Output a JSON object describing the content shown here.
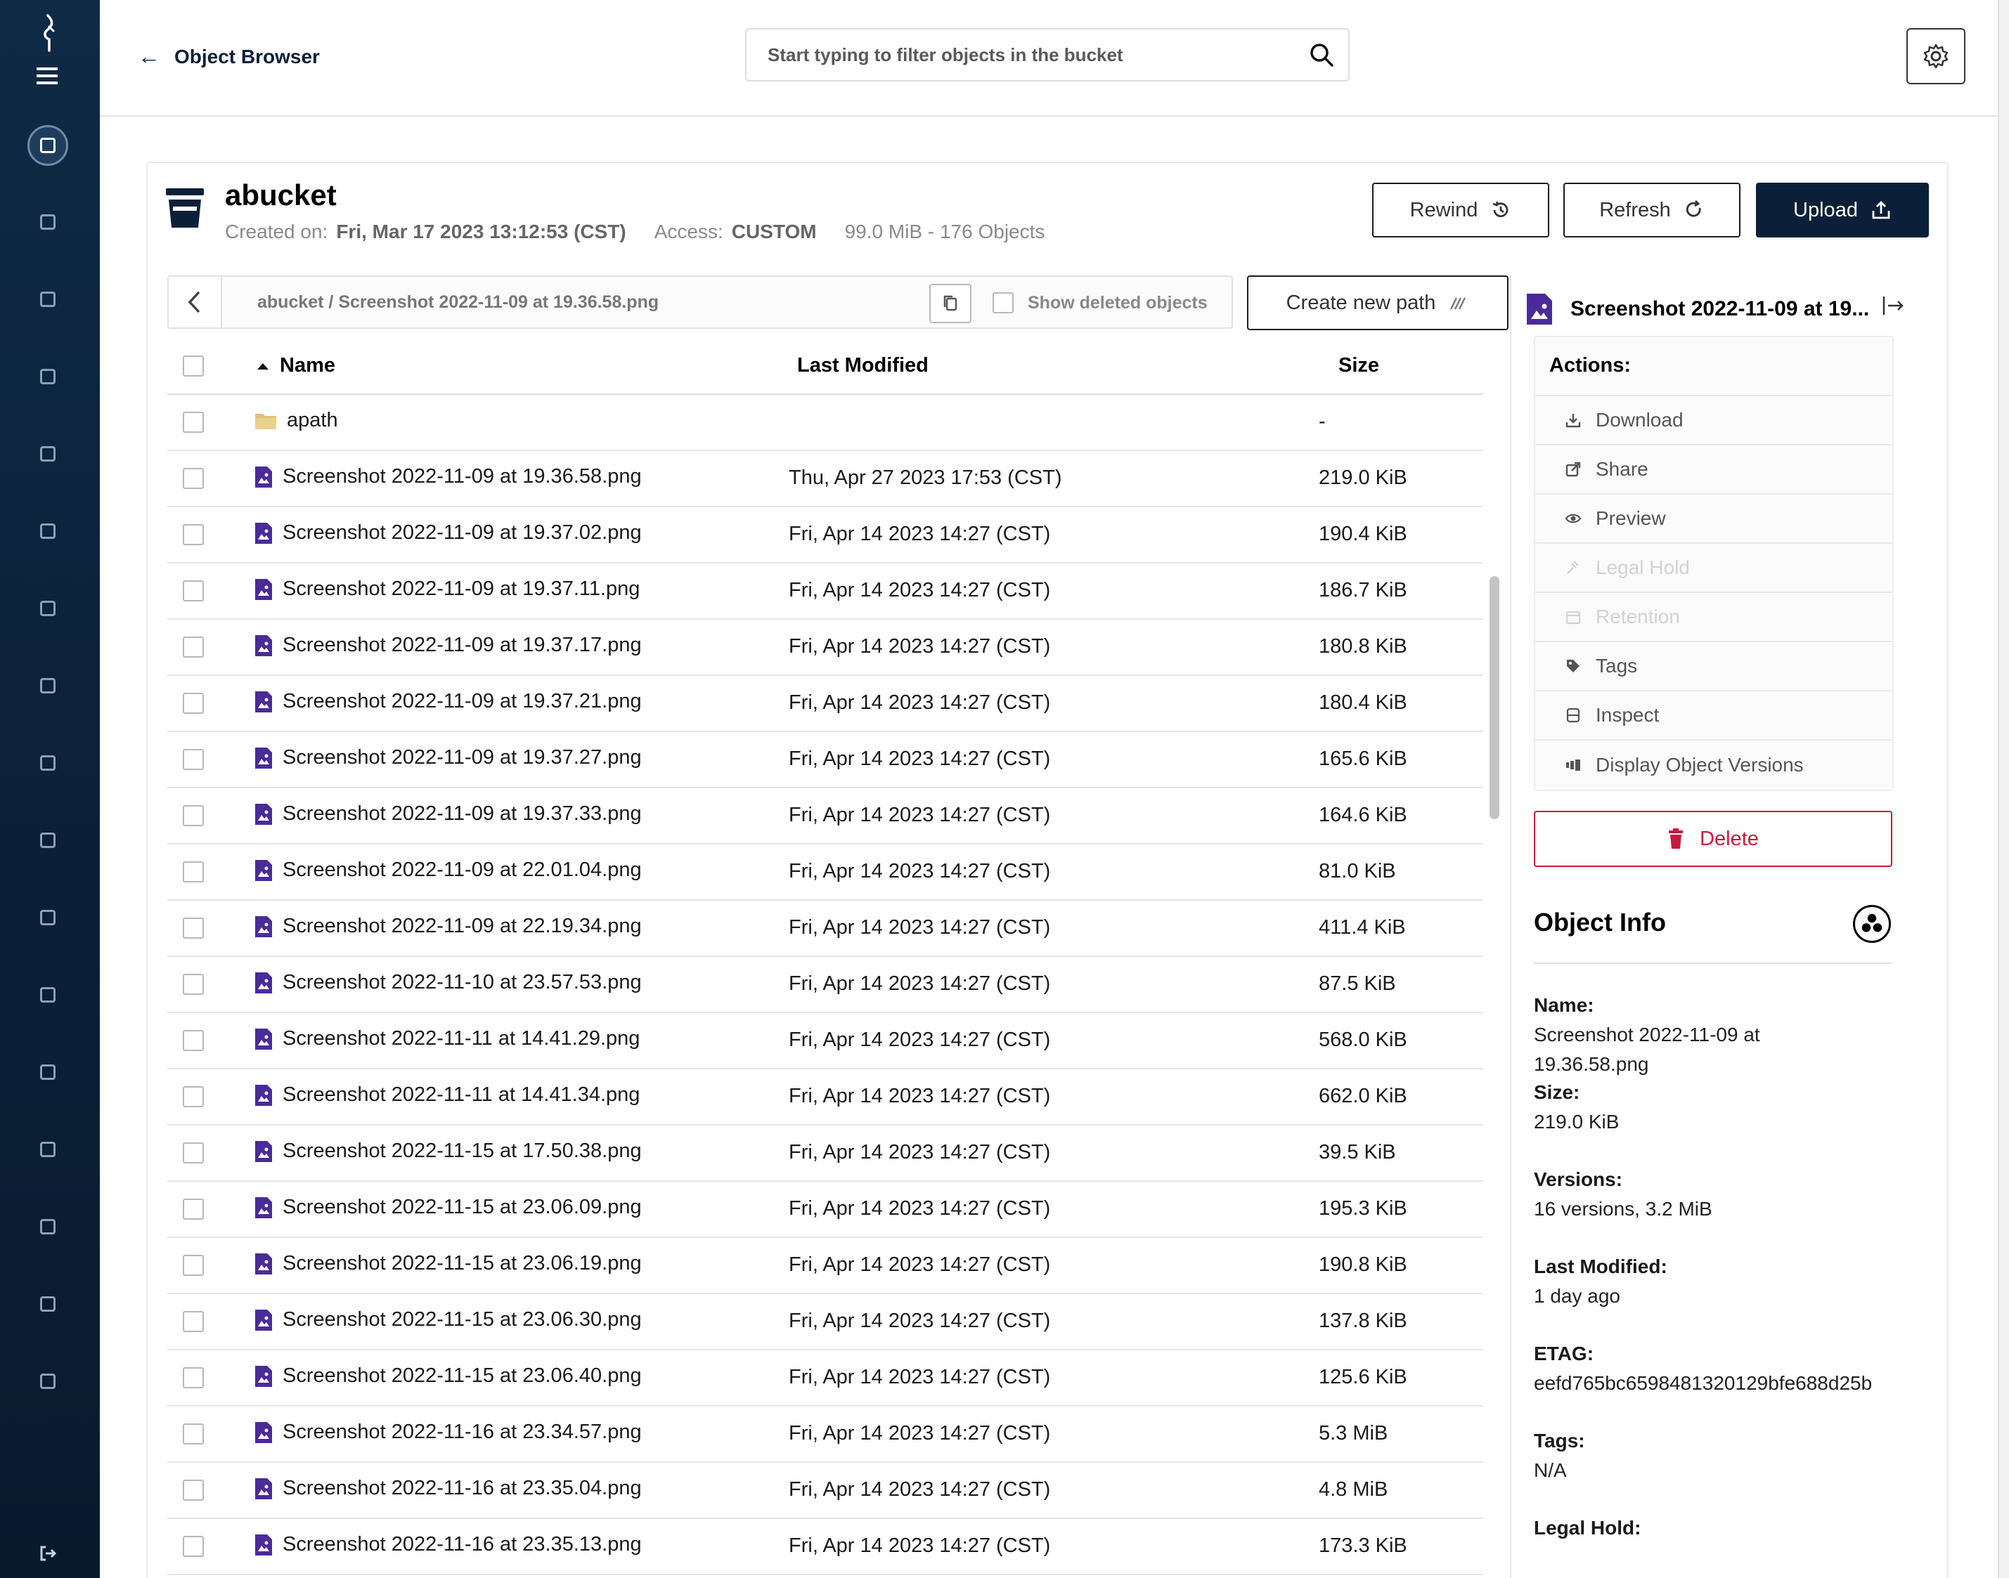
{
  "header": {
    "back_label": "Object Browser",
    "search_placeholder": "Start typing to filter objects in the bucket"
  },
  "bucket": {
    "name": "abucket",
    "created_label": "Created on:",
    "created_value": "Fri, Mar 17 2023 13:12:53 (CST)",
    "access_label": "Access:",
    "access_value": "CUSTOM",
    "usage": "99.0 MiB - 176 Objects"
  },
  "buttons": {
    "rewind": "Rewind",
    "refresh": "Refresh",
    "upload": "Upload",
    "create_path": "Create new path"
  },
  "breadcrumb": {
    "text": "abucket  /  Screenshot 2022-11-09 at 19.36.58.png",
    "show_deleted": "Show deleted objects"
  },
  "table": {
    "columns": {
      "name": "Name",
      "last_modified": "Last Modified",
      "size": "Size"
    },
    "rows": [
      {
        "type": "folder",
        "name": "apath",
        "modified": "",
        "size": "-"
      },
      {
        "type": "file",
        "name": "Screenshot 2022-11-09 at 19.36.58.png",
        "modified": "Thu, Apr 27 2023 17:53 (CST)",
        "size": "219.0 KiB"
      },
      {
        "type": "file",
        "name": "Screenshot 2022-11-09 at 19.37.02.png",
        "modified": "Fri, Apr 14 2023 14:27 (CST)",
        "size": "190.4 KiB"
      },
      {
        "type": "file",
        "name": "Screenshot 2022-11-09 at 19.37.11.png",
        "modified": "Fri, Apr 14 2023 14:27 (CST)",
        "size": "186.7 KiB"
      },
      {
        "type": "file",
        "name": "Screenshot 2022-11-09 at 19.37.17.png",
        "modified": "Fri, Apr 14 2023 14:27 (CST)",
        "size": "180.8 KiB"
      },
      {
        "type": "file",
        "name": "Screenshot 2022-11-09 at 19.37.21.png",
        "modified": "Fri, Apr 14 2023 14:27 (CST)",
        "size": "180.4 KiB"
      },
      {
        "type": "file",
        "name": "Screenshot 2022-11-09 at 19.37.27.png",
        "modified": "Fri, Apr 14 2023 14:27 (CST)",
        "size": "165.6 KiB"
      },
      {
        "type": "file",
        "name": "Screenshot 2022-11-09 at 19.37.33.png",
        "modified": "Fri, Apr 14 2023 14:27 (CST)",
        "size": "164.6 KiB"
      },
      {
        "type": "file",
        "name": "Screenshot 2022-11-09 at 22.01.04.png",
        "modified": "Fri, Apr 14 2023 14:27 (CST)",
        "size": "81.0 KiB"
      },
      {
        "type": "file",
        "name": "Screenshot 2022-11-09 at 22.19.34.png",
        "modified": "Fri, Apr 14 2023 14:27 (CST)",
        "size": "411.4 KiB"
      },
      {
        "type": "file",
        "name": "Screenshot 2022-11-10 at 23.57.53.png",
        "modified": "Fri, Apr 14 2023 14:27 (CST)",
        "size": "87.5 KiB"
      },
      {
        "type": "file",
        "name": "Screenshot 2022-11-11 at 14.41.29.png",
        "modified": "Fri, Apr 14 2023 14:27 (CST)",
        "size": "568.0 KiB"
      },
      {
        "type": "file",
        "name": "Screenshot 2022-11-11 at 14.41.34.png",
        "modified": "Fri, Apr 14 2023 14:27 (CST)",
        "size": "662.0 KiB"
      },
      {
        "type": "file",
        "name": "Screenshot 2022-11-15 at 17.50.38.png",
        "modified": "Fri, Apr 14 2023 14:27 (CST)",
        "size": "39.5 KiB"
      },
      {
        "type": "file",
        "name": "Screenshot 2022-11-15 at 23.06.09.png",
        "modified": "Fri, Apr 14 2023 14:27 (CST)",
        "size": "195.3 KiB"
      },
      {
        "type": "file",
        "name": "Screenshot 2022-11-15 at 23.06.19.png",
        "modified": "Fri, Apr 14 2023 14:27 (CST)",
        "size": "190.8 KiB"
      },
      {
        "type": "file",
        "name": "Screenshot 2022-11-15 at 23.06.30.png",
        "modified": "Fri, Apr 14 2023 14:27 (CST)",
        "size": "137.8 KiB"
      },
      {
        "type": "file",
        "name": "Screenshot 2022-11-15 at 23.06.40.png",
        "modified": "Fri, Apr 14 2023 14:27 (CST)",
        "size": "125.6 KiB"
      },
      {
        "type": "file",
        "name": "Screenshot 2022-11-16 at 23.34.57.png",
        "modified": "Fri, Apr 14 2023 14:27 (CST)",
        "size": "5.3 MiB"
      },
      {
        "type": "file",
        "name": "Screenshot 2022-11-16 at 23.35.04.png",
        "modified": "Fri, Apr 14 2023 14:27 (CST)",
        "size": "4.8 MiB"
      },
      {
        "type": "file",
        "name": "Screenshot 2022-11-16 at 23.35.13.png",
        "modified": "Fri, Apr 14 2023 14:27 (CST)",
        "size": "173.3 KiB"
      }
    ]
  },
  "panel": {
    "title": "Screenshot 2022-11-09 at 19...",
    "actions_label": "Actions:",
    "actions": [
      {
        "label": "Download",
        "icon": "download-icon",
        "enabled": true
      },
      {
        "label": "Share",
        "icon": "share-icon",
        "enabled": true
      },
      {
        "label": "Preview",
        "icon": "eye-icon",
        "enabled": true
      },
      {
        "label": "Legal Hold",
        "icon": "gavel-icon",
        "enabled": false
      },
      {
        "label": "Retention",
        "icon": "calendar-icon",
        "enabled": false
      },
      {
        "label": "Tags",
        "icon": "tag-icon",
        "enabled": true
      },
      {
        "label": "Inspect",
        "icon": "inspect-icon",
        "enabled": true
      },
      {
        "label": "Display Object Versions",
        "icon": "versions-icon",
        "enabled": true
      }
    ],
    "delete_label": "Delete",
    "info_title": "Object Info",
    "info": {
      "name_label": "Name:",
      "name_value": "Screenshot 2022-11-09 at 19.36.58.png",
      "size_label": "Size:",
      "size_value": "219.0 KiB",
      "versions_label": "Versions:",
      "versions_value": "16 versions, 3.2 MiB",
      "modified_label": "Last Modified:",
      "modified_value": "1 day ago",
      "etag_label": "ETAG:",
      "etag_value": "eefd765bc6598481320129bfe688d25b",
      "tags_label": "Tags:",
      "tags_value": "N/A",
      "legal_hold_label": "Legal Hold:"
    }
  },
  "colors": {
    "sidebar": "#0b2038",
    "accent_dark": "#0b2038",
    "file_icon": "#4b2a9a",
    "folder_icon": "#e2c275",
    "danger": "#c51b3c"
  }
}
